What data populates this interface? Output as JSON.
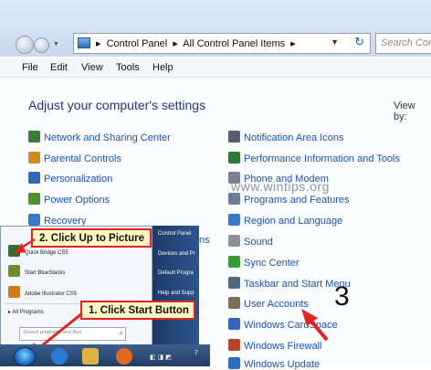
{
  "window": {
    "breadcrumb": [
      "Control Panel",
      "All Control Panel Items"
    ],
    "search_placeholder": "Search Con",
    "menu": [
      "File",
      "Edit",
      "View",
      "Tools",
      "Help"
    ],
    "heading": "Adjust your computer's settings",
    "view_by": "View by:"
  },
  "left_items": [
    {
      "label": "Network and Sharing Center",
      "icon": "network-icon",
      "color": "#3a7a3a"
    },
    {
      "label": "Parental Controls",
      "icon": "parental-icon",
      "color": "#d08a20"
    },
    {
      "label": "Personalization",
      "icon": "personalization-icon",
      "color": "#3566b5"
    },
    {
      "label": "Power Options",
      "icon": "power-icon",
      "color": "#4f8f2f"
    },
    {
      "label": "Recovery",
      "icon": "recovery-icon",
      "color": "#3d78c8"
    }
  ],
  "right_items": [
    {
      "label": "Notification Area Icons",
      "icon": "notification-icon",
      "color": "#555e6b"
    },
    {
      "label": "Performance Information and Tools",
      "icon": "performance-icon",
      "color": "#2d7a3a"
    },
    {
      "label": "Phone and Modem",
      "icon": "phone-icon",
      "color": "#7a8290"
    },
    {
      "label": "Programs and Features",
      "icon": "programs-icon",
      "color": "#6a7d95"
    },
    {
      "label": "Region and Language",
      "icon": "region-icon",
      "color": "#3c78c0"
    },
    {
      "label": "Sound",
      "icon": "sound-icon",
      "color": "#8a8f98"
    },
    {
      "label": "Sync Center",
      "icon": "sync-icon",
      "color": "#3a9a3a"
    },
    {
      "label": "Taskbar and Start Menu",
      "icon": "taskbar-icon",
      "color": "#4f6780"
    },
    {
      "label": "User Accounts",
      "icon": "user-accounts-icon",
      "color": "#7b6f5a"
    },
    {
      "label": "Windows CardSpace",
      "icon": "cardspace-icon",
      "color": "#3566b5"
    },
    {
      "label": "Windows Firewall",
      "icon": "firewall-icon",
      "color": "#b5452a"
    },
    {
      "label": "Windows Update",
      "icon": "update-icon",
      "color": "#2f6dbb"
    }
  ],
  "partial_text": "ns",
  "watermark": "www.wintips.org",
  "start_menu": {
    "items": [
      {
        "label": "Quick Bridge CS5",
        "icon": "quick-bridge-icon",
        "color": "#2f6f2f"
      },
      {
        "label": "Start BlueStacks",
        "icon": "bluestacks-icon",
        "color": "#6a8f2a"
      },
      {
        "label": "Adobe Illustrator CS5",
        "icon": "illustrator-icon",
        "color": "#d07a10"
      }
    ],
    "all_programs": "All Programs",
    "search_placeholder": "Search programs and files",
    "right_items": [
      "Control Panel",
      "Devices and Pr",
      "Default Progra",
      "Help and Supp"
    ]
  },
  "callouts": {
    "step1": "1. Click Start Button",
    "step2": "2. Click Up to Picture",
    "step3": "3"
  },
  "taskbar": {
    "icons": [
      {
        "name": "ie-icon",
        "color": "#2b7bd6"
      },
      {
        "name": "explorer-icon",
        "color": "#e0b040"
      },
      {
        "name": "media-player-icon",
        "color": "#e06a20"
      }
    ],
    "tray_text": "7"
  },
  "colors": {
    "accent_red": "#e02424",
    "link_blue": "#1a54b0"
  }
}
